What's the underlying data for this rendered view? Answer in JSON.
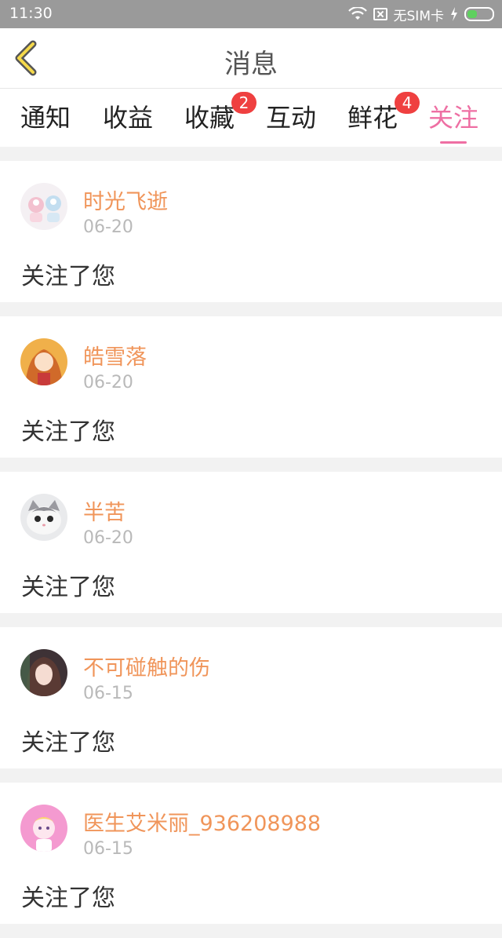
{
  "status": {
    "time": "11:30",
    "carrier": "无SIM卡"
  },
  "header": {
    "title": "消息"
  },
  "tabs": [
    {
      "label": "通知",
      "badge": ""
    },
    {
      "label": "收益",
      "badge": ""
    },
    {
      "label": "收藏",
      "badge": "2"
    },
    {
      "label": "互动",
      "badge": ""
    },
    {
      "label": "鲜花",
      "badge": "4"
    },
    {
      "label": "关注",
      "badge": "",
      "active": true
    }
  ],
  "colors": {
    "accent": "#ee6fa3",
    "username": "#f0955a",
    "badge": "#ef4040"
  },
  "messages": [
    {
      "name": "时光飞逝",
      "date": "06-20",
      "text": "关注了您"
    },
    {
      "name": "皓雪落",
      "date": "06-20",
      "text": "关注了您"
    },
    {
      "name": "半苦",
      "date": "06-20",
      "text": "关注了您"
    },
    {
      "name": "不可碰触的伤",
      "date": "06-15",
      "text": "关注了您"
    },
    {
      "name": "医生艾米丽_936208988",
      "date": "06-15",
      "text": "关注了您"
    }
  ]
}
